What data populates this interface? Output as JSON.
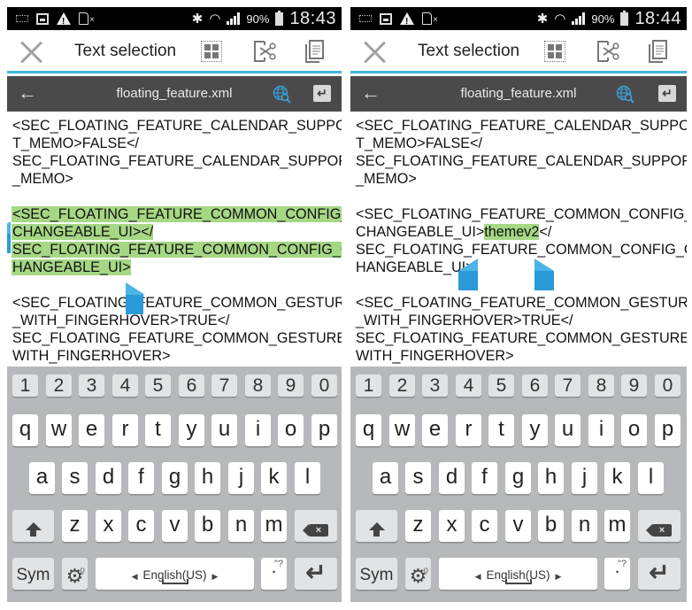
{
  "phones": [
    {
      "status_bar": {
        "battery_pct": "90%",
        "time": "18:43"
      },
      "action_bar": {
        "title": "Text selection"
      },
      "file_bar": {
        "file_name": "floating_feature.xml",
        "back_icon": "←",
        "enter_icon": "↵"
      },
      "text": {
        "lines": [
          "<SEC_FLOATING_FEATURE_CALENDAR_SUPPOR",
          "T_MEMO>FALSE</",
          "SEC_FLOATING_FEATURE_CALENDAR_SUPPORT",
          "_MEMO>",
          "",
          "<SEC_FLOATING_FEATURE_COMMON_CONFIG_",
          "CHANGEABLE_UI></",
          "SEC_FLOATING_FEATURE_COMMON_CONFIG_C",
          "HANGEABLE_UI>",
          "",
          "<SEC_FLOATING_FEATURE_COMMON_GESTURE",
          "_WITH_FINGERHOVER>TRUE</",
          "SEC_FLOATING_FEATURE_COMMON_GESTURE_",
          "WITH_FINGERHOVER>"
        ],
        "selection": "<SEC_FLOATING_FEATURE_COMMON_CONFIG_CHANGEABLE_UI></SEC_FLOATING_FEATURE_COMMON_CONFIG_CHANGEABLE_UI>"
      }
    },
    {
      "status_bar": {
        "battery_pct": "90%",
        "time": "18:44"
      },
      "action_bar": {
        "title": "Text selection"
      },
      "file_bar": {
        "file_name": "floating_feature.xml",
        "back_icon": "←",
        "enter_icon": "↵"
      },
      "text": {
        "lines": [
          "<SEC_FLOATING_FEATURE_CALENDAR_SUPPOR",
          "T_MEMO>FALSE</",
          "SEC_FLOATING_FEATURE_CALENDAR_SUPPORT",
          "_MEMO>",
          "",
          "<SEC_FLOATING_FEATURE_COMMON_CONFIG_",
          "CHANGEABLE_UI>",
          "SEC_FLOATING_FEATURE_COMMON_CONFIG_C",
          "HANGEABLE_UI>",
          "",
          "<SEC_FLOATING_FEATURE_COMMON_GESTURE",
          "_WITH_FINGERHOVER>TRUE</",
          "SEC_FLOATING_FEATURE_COMMON_GESTURE_",
          "WITH_FINGERHOVER>"
        ],
        "selected_word": "themev2",
        "after_selection": "</",
        "selection": "themev2"
      }
    }
  ],
  "keyboard": {
    "number_row": [
      "1",
      "2",
      "3",
      "4",
      "5",
      "6",
      "7",
      "8",
      "9",
      "0"
    ],
    "row1": [
      "q",
      "w",
      "e",
      "r",
      "t",
      "y",
      "u",
      "i",
      "o",
      "p"
    ],
    "row2": [
      "a",
      "s",
      "d",
      "f",
      "g",
      "h",
      "j",
      "k",
      "l"
    ],
    "row3": [
      "z",
      "x",
      "c",
      "v",
      "b",
      "n",
      "m"
    ],
    "sym_label": "Sym",
    "language_label": "English(US)",
    "period_label": ".",
    "period_extra": "\"?",
    "backspace_glyph": "×",
    "enter_glyph": "↵",
    "gear_glyph": "⚙",
    "mic_glyph": "··🎙",
    "lang_left": "◀",
    "lang_right": "▶"
  },
  "colors": {
    "accent": "#3fb7d9",
    "selection": "#a6d785",
    "handle": "#2a9ad9",
    "file_bar": "#4a4a4a",
    "keyboard_bg": "#b7b8bb"
  }
}
